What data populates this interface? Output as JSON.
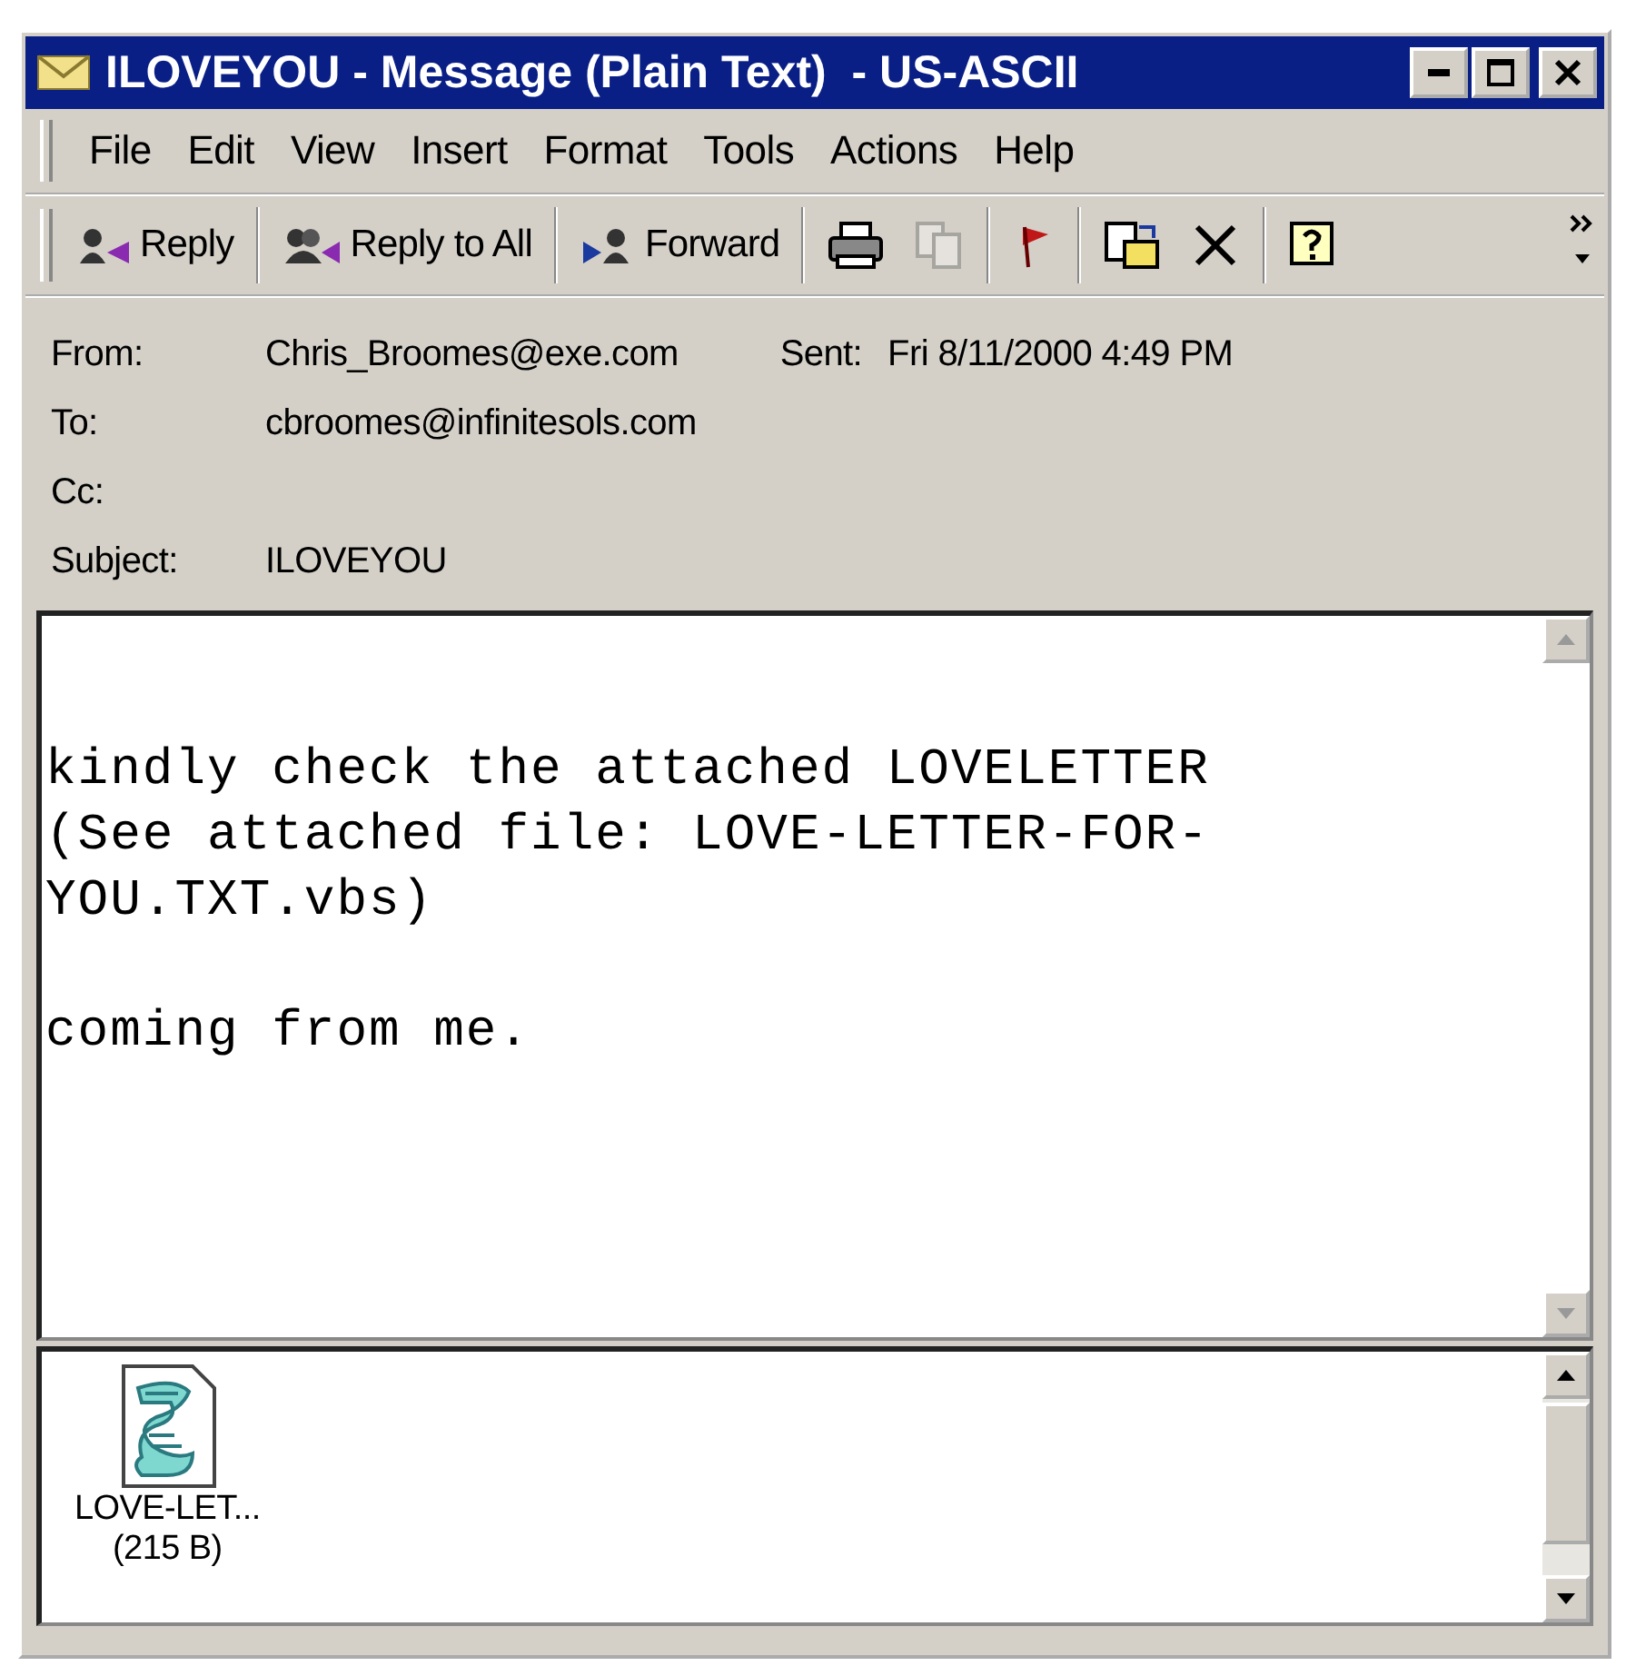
{
  "window": {
    "title": "ILOVEYOU - Message (Plain Text)  - US-ASCII"
  },
  "menu": [
    {
      "label": "File"
    },
    {
      "label": "Edit"
    },
    {
      "label": "View"
    },
    {
      "label": "Insert"
    },
    {
      "label": "Format"
    },
    {
      "label": "Tools"
    },
    {
      "label": "Actions"
    },
    {
      "label": "Help"
    }
  ],
  "toolbar": [
    {
      "kind": "text",
      "label": "Reply",
      "disabled": false
    },
    {
      "kind": "text",
      "label": "Reply to All",
      "disabled": false
    },
    {
      "kind": "text",
      "label": "Forward",
      "disabled": false
    },
    {
      "kind": "icon",
      "disabled": false
    },
    {
      "kind": "icon",
      "disabled": true
    },
    {
      "kind": "icon",
      "disabled": false
    },
    {
      "kind": "icon",
      "disabled": false
    },
    {
      "kind": "icon",
      "disabled": false
    },
    {
      "kind": "icon",
      "disabled": false
    }
  ],
  "header": {
    "fields": [
      {
        "label": "From:",
        "value": "Chris_Broomes@exe.com"
      },
      {
        "label": "To:",
        "value": "cbroomes@infinitesols.com"
      },
      {
        "label": "Cc:"
      },
      {
        "label": "Subject:",
        "value": "ILOVEYOU"
      }
    ],
    "sent": {
      "label": "Sent:",
      "value": "Fri 8/11/2000 4:49 PM"
    }
  },
  "body": {
    "paragraphs": [
      "kindly check the attached LOVELETTER\n(See attached file: LOVE-LETTER-FOR-\nYOU.TXT.vbs)",
      "coming from me."
    ]
  },
  "attachments": [
    {
      "name": "LOVE-LET...",
      "size": "(215 B)"
    }
  ]
}
